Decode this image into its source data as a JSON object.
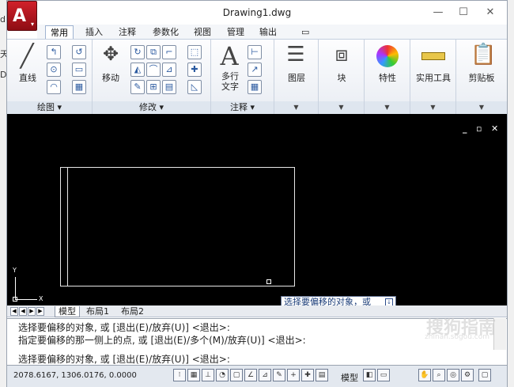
{
  "window": {
    "title": "Drawing1.dwg",
    "minimize": "—",
    "maximize": "☐",
    "close": "✕"
  },
  "app_button": {
    "letter": "A",
    "arrow": "▾"
  },
  "ribbon_tabs": [
    "常用",
    "插入",
    "注释",
    "参数化",
    "视图",
    "管理",
    "输出",
    "▭"
  ],
  "panels": {
    "draw": {
      "label": "绘图 ▾",
      "line": "直线"
    },
    "modify": {
      "label": "修改 ▾",
      "move": "移动"
    },
    "annotation": {
      "label": "注释 ▾",
      "mtext": "多行\n文字"
    },
    "layers": {
      "label": "图层"
    },
    "block": {
      "label": "块"
    },
    "properties": {
      "label": "特性"
    },
    "utilities": {
      "label": "实用工具"
    },
    "clipboard": {
      "label": "剪贴板"
    }
  },
  "viewport_controls": [
    "_",
    "▫",
    "✕"
  ],
  "ucs": {
    "y": "Y",
    "x": "X"
  },
  "tooltip": {
    "text": "选择要偏移的对象，或"
  },
  "layout_tabs": [
    "模型",
    "布局1",
    "布局2"
  ],
  "command_history": [
    "选择要偏移的对象, 或 [退出(E)/放弃(U)] <退出>:",
    "指定要偏移的那一侧上的点, 或 [退出(E)/多个(M)/放弃(U)] <退出>:",
    "选择要偏移的对象, 或 [退出(E)/放弃(U)] <退出>:"
  ],
  "status": {
    "coords": "2078.6167, 1306.0176, 0.0000",
    "model_label": "模型"
  },
  "watermark": {
    "main": "搜狗指南",
    "sub": "zhinan.sogou.com"
  },
  "background_edge": {
    "left_texts": [
      "di",
      "天",
      "D"
    ]
  }
}
